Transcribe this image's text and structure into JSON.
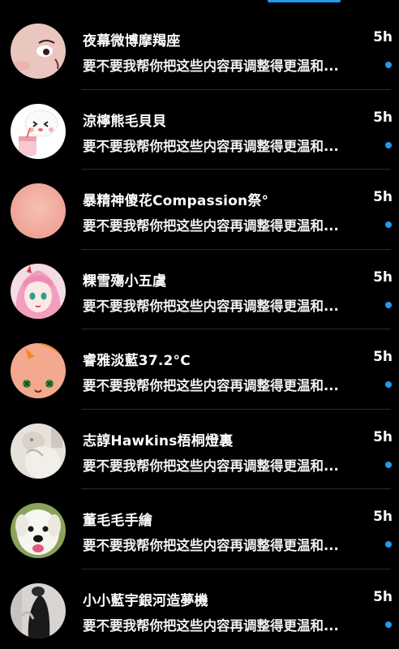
{
  "accent_color": "#1d9bf0",
  "conversations": [
    {
      "name": "夜幕微博摩羯座",
      "time": "5h",
      "preview": "要不要我帮你把这些内容再调整得更温和...",
      "unread": true,
      "avatar_icon": "pink-face-avatar"
    },
    {
      "name": "涼檸熊毛貝貝",
      "time": "5h",
      "preview": "要不要我帮你把这些内容再调整得更温和...",
      "unread": true,
      "avatar_icon": "cartoon-bear-drink-avatar"
    },
    {
      "name": "暴精神傻花Compassion祭°",
      "time": "5h",
      "preview": "要不要我帮你把这些内容再调整得更温和...",
      "unread": true,
      "avatar_icon": "peach-circle-avatar"
    },
    {
      "name": "粿雪殤小五虞",
      "time": "5h",
      "preview": "要不要我帮你把这些内容再调整得更温和...",
      "unread": true,
      "avatar_icon": "anime-pink-hair-avatar"
    },
    {
      "name": "睿雅淡藍37.2°C",
      "time": "5h",
      "preview": "要不要我帮你把这些内容再调整得更温和...",
      "unread": true,
      "avatar_icon": "orange-cartoon-avatar"
    },
    {
      "name": "志諄Hawkins梧桐燈裏",
      "time": "5h",
      "preview": "要不要我帮你把这些内容再调整得更温和...",
      "unread": true,
      "avatar_icon": "faded-photo-avatar"
    },
    {
      "name": "董毛毛手繪",
      "time": "5h",
      "preview": "要不要我帮你把这些内容再调整得更温和...",
      "unread": true,
      "avatar_icon": "white-dog-avatar"
    },
    {
      "name": "小小藍宇銀河造夢機",
      "time": "5h",
      "preview": "要不要我帮你把这些内容再调整得更温和...",
      "unread": true,
      "avatar_icon": "dark-figure-avatar"
    }
  ]
}
